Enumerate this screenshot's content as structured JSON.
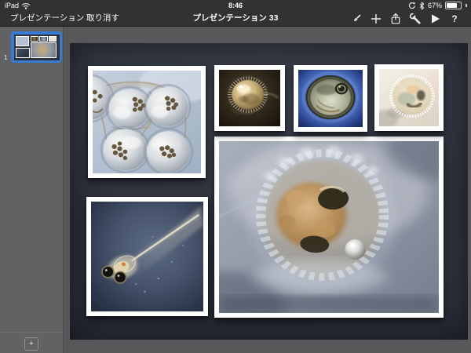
{
  "status_bar": {
    "device_label": "iPad",
    "time": "8:46",
    "battery_level": "67%"
  },
  "toolbar": {
    "presentations_button": "プレゼンテーション",
    "undo_button": "取り消す",
    "document_title": "プレゼンテーション 33",
    "help_button": "?",
    "icon_names": [
      "format-brush-icon",
      "add-icon",
      "share-icon",
      "tools-icon",
      "play-icon",
      "help-icon"
    ]
  },
  "slide_navigator": {
    "slide_number": "1",
    "add_slide_button": "+"
  },
  "slide": {
    "photo_names": [
      "egg-cluster-photo",
      "dark-fuzzy-egg-photo",
      "blue-ring-egg-photo",
      "pale-egg-photo",
      "fish-larva-photo",
      "embryo-macro-photo"
    ]
  },
  "colors": {
    "selection_blue": "#3a7bd5",
    "top_bar": "#323234",
    "canvas": "#58585a",
    "sidebar": "#626264",
    "slide_background": "#2e323c"
  }
}
